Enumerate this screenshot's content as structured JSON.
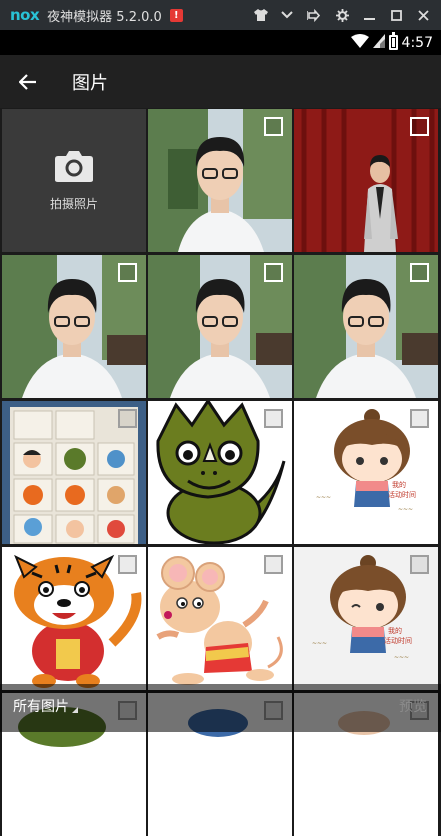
{
  "emulator": {
    "logo": "nox",
    "title": "夜神模拟器 5.2.0.0",
    "badge": "!",
    "controls": [
      "shirt-icon",
      "chevron-down-icon",
      "pin-icon",
      "gear-icon",
      "minimize-icon",
      "maximize-icon",
      "close-icon"
    ]
  },
  "status": {
    "time": "4:57"
  },
  "app_bar": {
    "title": "图片"
  },
  "camera_tile": {
    "label": "拍摄照片"
  },
  "bottom_bar": {
    "folder_label": "所有图片",
    "preview_label": "预览"
  },
  "colors": {
    "app_bar": "#212121",
    "nox_cyan": "#29c3d6",
    "badge_red": "#e53935",
    "shirt_red": "#d32f2f"
  }
}
